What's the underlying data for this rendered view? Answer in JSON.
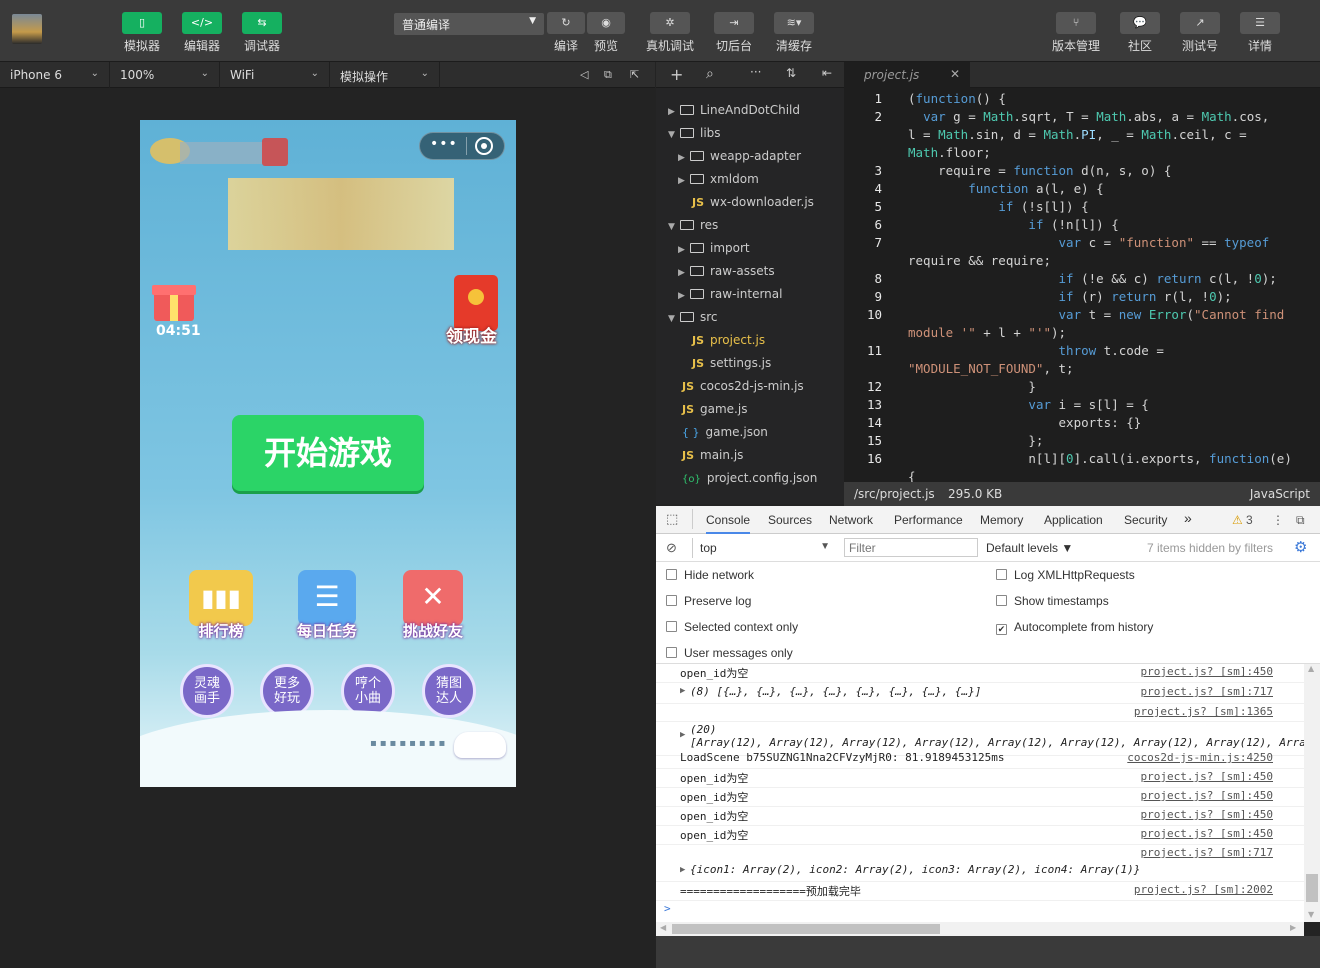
{
  "toolbar": {
    "simulator": "模拟器",
    "editor": "编辑器",
    "debugger": "调试器",
    "compile_mode": "普通编译",
    "compile": "编译",
    "preview": "预览",
    "remote_debug": "真机调试",
    "background": "切后台",
    "clear_cache": "清缓存",
    "version": "版本管理",
    "community": "社区",
    "test_account": "测试号",
    "details": "详情"
  },
  "devicebar": {
    "device": "iPhone 6",
    "zoom": "100%",
    "network": "WiFi",
    "simulate": "模拟操作"
  },
  "game": {
    "timer": "04:51",
    "cash": "领现金",
    "start": "开始游戏",
    "tiles": [
      {
        "label": "排行榜",
        "color": "#f2c94c"
      },
      {
        "label": "每日任务",
        "color": "#5aa9ee"
      },
      {
        "label": "挑战好友",
        "color": "#ef6b6b"
      }
    ],
    "circles": [
      {
        "line1": "灵魂",
        "line2": "画手"
      },
      {
        "line1": "更多",
        "line2": "好玩"
      },
      {
        "line1": "哼个",
        "line2": "小曲"
      },
      {
        "line1": "猜图",
        "line2": "达人"
      }
    ]
  },
  "tree": {
    "nodes": [
      {
        "name": "LineAndDotChild",
        "type": "folder",
        "open": false
      },
      {
        "name": "libs",
        "type": "folder",
        "open": true
      },
      {
        "name": "weapp-adapter",
        "type": "folder",
        "open": false
      },
      {
        "name": "xmldom",
        "type": "folder",
        "open": false
      },
      {
        "name": "wx-downloader.js",
        "type": "js"
      },
      {
        "name": "res",
        "type": "folder",
        "open": true
      },
      {
        "name": "import",
        "type": "folder",
        "open": false
      },
      {
        "name": "raw-assets",
        "type": "folder",
        "open": false
      },
      {
        "name": "raw-internal",
        "type": "folder",
        "open": false
      },
      {
        "name": "src",
        "type": "folder",
        "open": true
      },
      {
        "name": "project.js",
        "type": "js",
        "selected": true
      },
      {
        "name": "settings.js",
        "type": "js"
      },
      {
        "name": "cocos2d-js-min.js",
        "type": "js"
      },
      {
        "name": "game.js",
        "type": "js"
      },
      {
        "name": "game.json",
        "type": "json"
      },
      {
        "name": "main.js",
        "type": "js"
      },
      {
        "name": "project.config.json",
        "type": "json2"
      }
    ]
  },
  "editor": {
    "tab": "project.js",
    "line_numbers": [
      "1",
      "2",
      "3",
      "4",
      "5",
      "6",
      "7",
      "8",
      "9",
      "10",
      "11",
      "12",
      "13",
      "14",
      "15",
      "16"
    ],
    "path": "/src/project.js",
    "size": "295.0 KB",
    "language": "JavaScript"
  },
  "devtools": {
    "tabs": [
      "Console",
      "Sources",
      "Network",
      "Performance",
      "Memory",
      "Application",
      "Security"
    ],
    "more": "»",
    "warnings": "3",
    "context": "top",
    "filter_placeholder": "Filter",
    "levels": "Default levels",
    "hidden": "7 items hidden by filters",
    "options": [
      "Hide network",
      "Preserve log",
      "Selected context only",
      "User messages only",
      "Log XMLHttpRequests",
      "Show timestamps",
      "Autocomplete from history"
    ],
    "autocomplete_checked": true
  },
  "console": [
    {
      "msg": "open_id为空",
      "src": "project.js? [sm]:450"
    },
    {
      "msg": "(8) [{…}, {…}, {…}, {…}, {…}, {…}, {…}, {…}]",
      "src": "project.js? [sm]:717",
      "expand": true
    },
    {
      "msg": "",
      "src": "project.js? [sm]:1365"
    },
    {
      "msg": "(20)",
      "msg2": "[Array(12), Array(12), Array(12), Array(12), Array(12), Array(12), Array(12), Array(12), Arra",
      "src": "",
      "expand": true
    },
    {
      "msg": "LoadScene b75SUZNG1Nna2CFVzyMjR0: 81.9189453125ms",
      "src": "cocos2d-js-min.js:4250"
    },
    {
      "msg": "open_id为空",
      "src": "project.js? [sm]:450"
    },
    {
      "msg": "open_id为空",
      "src": "project.js? [sm]:450"
    },
    {
      "msg": "open_id为空",
      "src": "project.js? [sm]:450"
    },
    {
      "msg": "open_id为空",
      "src": "project.js? [sm]:450"
    },
    {
      "msg": "",
      "src": "project.js? [sm]:717"
    },
    {
      "msg": "{icon1: Array(2), icon2: Array(2), icon3: Array(2), icon4: Array(1)}",
      "src": "",
      "expand": true
    },
    {
      "msg": "===================预加载完毕",
      "src": "project.js? [sm]:2002"
    }
  ],
  "prompt": ">"
}
